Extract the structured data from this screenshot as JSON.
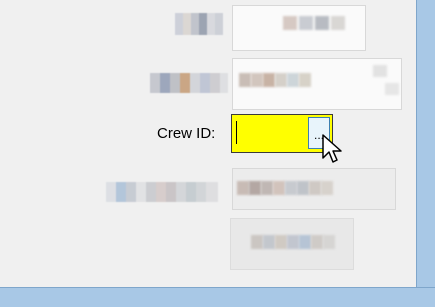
{
  "form": {
    "crew_label": "Crew ID:",
    "crew_value": "",
    "browse_label": "...",
    "input_bg": "#ffff00"
  },
  "icons": {
    "cursor": "arrow-pointer-icon"
  },
  "frame": {
    "border_color": "#a8c8e6"
  }
}
